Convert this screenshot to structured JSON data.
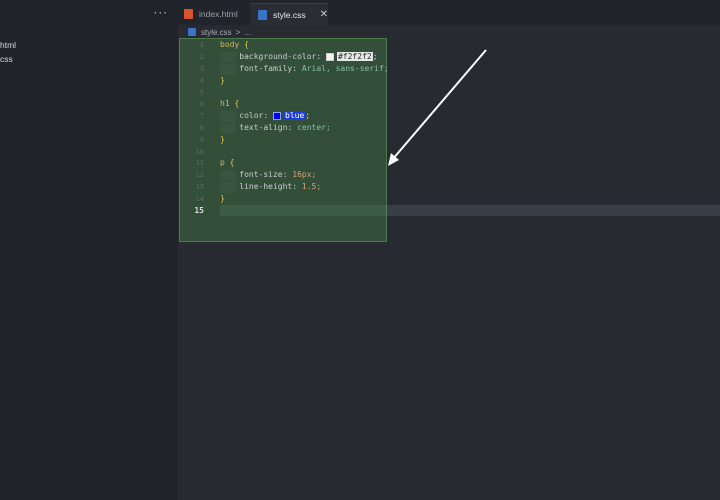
{
  "sidebar": {
    "more_label": "···",
    "files": [
      "html",
      "css"
    ]
  },
  "tabs": [
    {
      "label": "index.html",
      "icon": "html5-icon"
    },
    {
      "label": "style.css",
      "icon": "css3-icon",
      "active": true,
      "close": "✕"
    }
  ],
  "breadcrumb": {
    "file": "style.css",
    "separator": ">",
    "rest": "..."
  },
  "editor": {
    "line_numbers": [
      "1",
      "2",
      "3",
      "4",
      "5",
      "6",
      "7",
      "8",
      "9",
      "10",
      "11",
      "12",
      "13",
      "14",
      "15"
    ],
    "active_line": "15",
    "code": {
      "l1_sel": "body",
      "l2_prop": "background-color:",
      "l2_val": "#f2f2f2",
      "l3_prop": "font-family:",
      "l3_val": "Arial, sans-serif;",
      "l6_sel": "h1",
      "l7_prop": "color:",
      "l7_val": "blue",
      "l8_prop": "text-align:",
      "l8_val": "center;",
      "l11_sel": "p",
      "l12_prop": "font-size:",
      "l12_val": "16px;",
      "l13_prop": "line-height:",
      "l13_val": "1.5;",
      "open_brace": "{",
      "close_brace": "}"
    }
  },
  "colors": {
    "swatch_f2f2f2": "#f2f2f2",
    "swatch_blue": "#0000ff",
    "highlight": "#3f6b3f"
  }
}
